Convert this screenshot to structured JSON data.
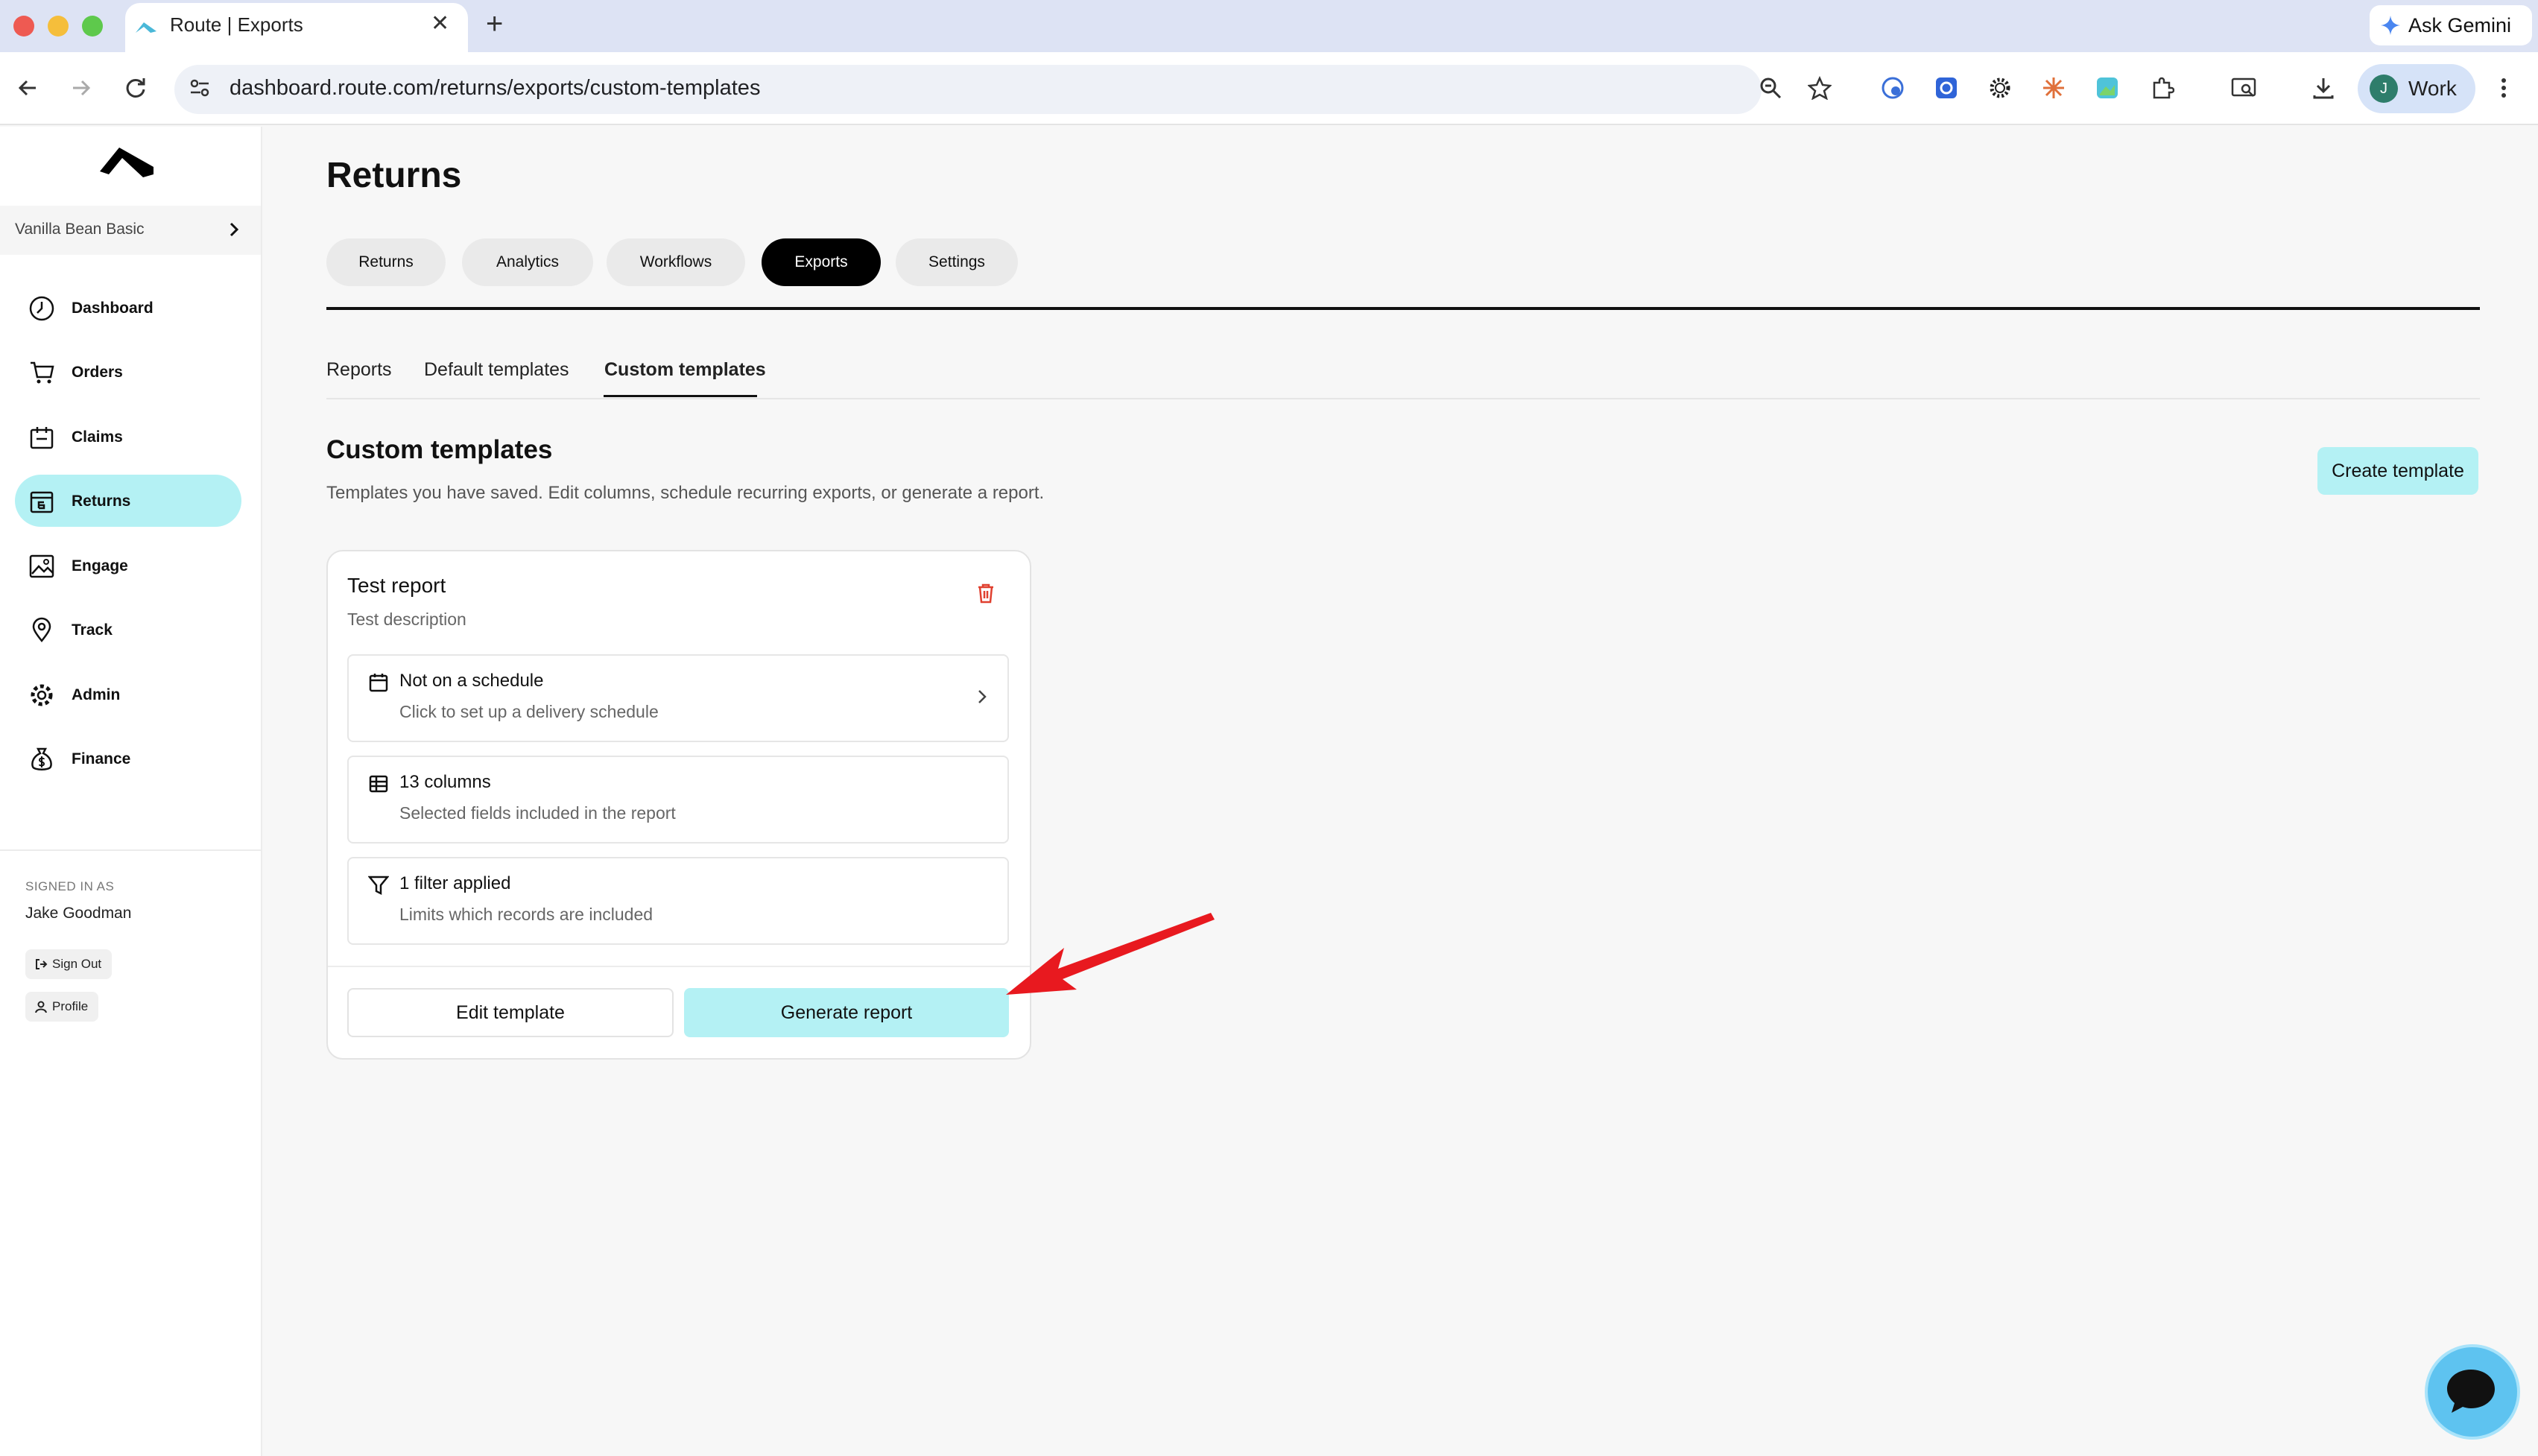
{
  "browser": {
    "tab_title": "Route | Exports",
    "url": "dashboard.route.com/returns/exports/custom-templates",
    "gemini_label": "Ask Gemini",
    "profile_initial": "J",
    "profile_label": "Work"
  },
  "sidebar": {
    "org_name": "Vanilla Bean Basic",
    "items": [
      {
        "label": "Dashboard",
        "icon": "dashboard-icon"
      },
      {
        "label": "Orders",
        "icon": "cart-icon"
      },
      {
        "label": "Claims",
        "icon": "claims-icon"
      },
      {
        "label": "Returns",
        "icon": "returns-icon",
        "active": true
      },
      {
        "label": "Engage",
        "icon": "image-icon"
      },
      {
        "label": "Track",
        "icon": "location-pin-icon"
      },
      {
        "label": "Admin",
        "icon": "gear-icon"
      },
      {
        "label": "Finance",
        "icon": "money-bag-icon"
      }
    ],
    "signed_in_label": "SIGNED IN AS",
    "user_name": "Jake Goodman",
    "sign_out_label": "Sign Out",
    "profile_label": "Profile"
  },
  "main": {
    "title": "Returns",
    "tabs": [
      "Returns",
      "Analytics",
      "Workflows",
      "Exports",
      "Settings"
    ],
    "active_tab": "Exports",
    "subtabs": [
      "Reports",
      "Default templates",
      "Custom templates"
    ],
    "active_subtab": "Custom templates",
    "section_title": "Custom templates",
    "section_desc": "Templates you have saved. Edit columns, schedule recurring exports, or generate a report.",
    "create_label": "Create template",
    "card": {
      "title": "Test report",
      "description": "Test description",
      "rows": [
        {
          "title": "Not on a schedule",
          "subtitle": "Click to set up a delivery schedule",
          "icon": "calendar-icon"
        },
        {
          "title": "13 columns",
          "subtitle": "Selected fields included in the report",
          "icon": "table-icon"
        },
        {
          "title": "1 filter applied",
          "subtitle": "Limits which records are included",
          "icon": "filter-icon"
        }
      ],
      "edit_label": "Edit template",
      "generate_label": "Generate report"
    }
  },
  "colors": {
    "accent": "#b4f1f4",
    "annotation_arrow": "#e8191f",
    "trash": "#e0402f",
    "chat_bubble": "#5ec3f0"
  }
}
